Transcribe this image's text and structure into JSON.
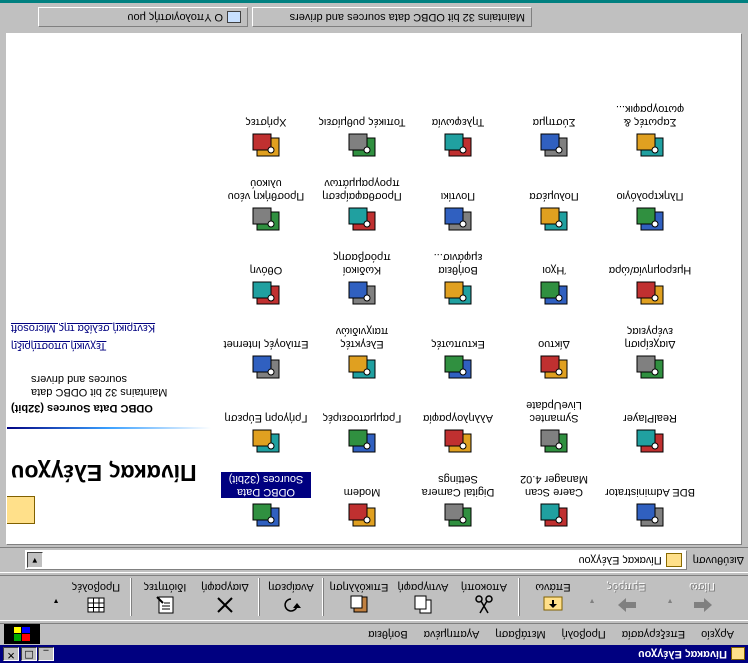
{
  "window": {
    "title": "Πίνακας Ελέγχου"
  },
  "menu": [
    "Αρχείο",
    "Επεξεργασία",
    "Προβολή",
    "Μετάβαση",
    "Αγαπημένα",
    "Βοήθεια"
  ],
  "toolbar": {
    "back": "Πίσω",
    "forward": "Εμπρός",
    "up": "Επάνω",
    "cut": "Αποκοπή",
    "copy": "Αντιγραφή",
    "paste": "Επικόλληση",
    "undo": "Αναίρεση",
    "delete": "Διαγραφή",
    "properties": "Ιδιότητες",
    "views": "Προβολές"
  },
  "address": {
    "label": "Διεύθυνση",
    "value": "Πίνακας Ελέγχου"
  },
  "left_pane": {
    "title": "Πίνακας Ελέγχου",
    "selected_name": "ODBC Data Sources (32bit)",
    "selected_desc": "Maintains 32 bit ODBC data sources and drivers",
    "link_home": "Κεντρική σελίδα της Microsoft",
    "link_support": "Τεχνική υποστήριξη"
  },
  "items": [
    {
      "label": "ODBC Data Sources (32bit)",
      "icon": "odbc-icon"
    },
    {
      "label": "Modem",
      "icon": "modem-icon"
    },
    {
      "label": "Digital Camera Settings",
      "icon": "camera-icon"
    },
    {
      "label": "Caere Scan Manager 4.02",
      "icon": "scanner-icon"
    },
    {
      "label": "BDE Administrator",
      "icon": "bde-icon"
    },
    {
      "label": "Γρήγορη Εύρεση",
      "icon": "find-fast-icon"
    },
    {
      "label": "Γραμματοσειρές",
      "icon": "fonts-icon"
    },
    {
      "label": "Αλληλογραφία",
      "icon": "mail-icon"
    },
    {
      "label": "Symantec LiveUpdate",
      "icon": "liveupdate-icon"
    },
    {
      "label": "RealPlayer",
      "icon": "realplayer-icon"
    },
    {
      "label": "Επιλογές Internet",
      "icon": "internet-options-icon"
    },
    {
      "label": "Ελεγκτές παιχνιδιών",
      "icon": "game-controllers-icon"
    },
    {
      "label": "Εκτυπωτές",
      "icon": "printers-icon"
    },
    {
      "label": "Δίκτυο",
      "icon": "network-icon"
    },
    {
      "label": "Διαχείριση ενέργειας",
      "icon": "power-icon"
    },
    {
      "label": "Οθόνη",
      "icon": "display-icon"
    },
    {
      "label": "Κωδικοί πρόσβασης",
      "icon": "passwords-icon"
    },
    {
      "label": "Βοήθεια εμφάνισ...",
      "icon": "accessibility-icon"
    },
    {
      "label": "Ήχοι",
      "icon": "sounds-icon"
    },
    {
      "label": "Ημερομηνία/ώρα",
      "icon": "datetime-icon"
    },
    {
      "label": "Προσθήκη νέου υλικού",
      "icon": "add-hardware-icon"
    },
    {
      "label": "Προσθαφαίρεση προγραμμάτων",
      "icon": "add-remove-icon"
    },
    {
      "label": "Ποντίκι",
      "icon": "mouse-icon"
    },
    {
      "label": "Πολυμέσα",
      "icon": "multimedia-icon"
    },
    {
      "label": "Πληκτρολόγιο",
      "icon": "keyboard-icon"
    },
    {
      "label": "Χρήστες",
      "icon": "users-icon"
    },
    {
      "label": "Τοπικές ρυθμίσεις",
      "icon": "regional-icon"
    },
    {
      "label": "Τηλεφωνία",
      "icon": "telephony-icon"
    },
    {
      "label": "Σύστημα",
      "icon": "system-icon"
    },
    {
      "label": "Σαρωτές & φωτογραφικ...",
      "icon": "scanners-cameras-icon"
    }
  ],
  "status": {
    "description": "Maintains 32 bit ODBC data sources and drivers",
    "zone": "Ο Υπολογιστής μου"
  },
  "colors": {
    "title_bar": "#000080",
    "selection": "#000080",
    "window_face": "#c0c0c0"
  }
}
